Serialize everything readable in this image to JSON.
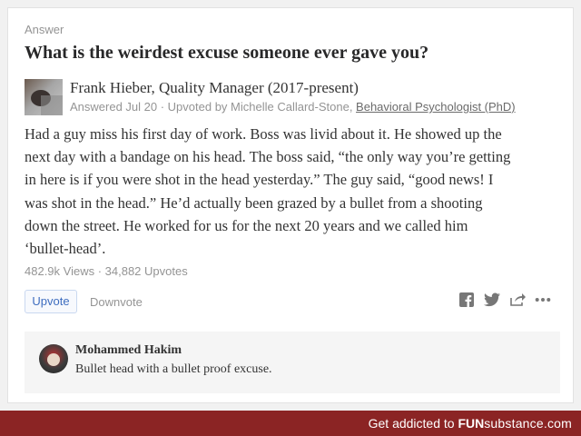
{
  "answer_label": "Answer",
  "question": "What is the weirdest excuse someone ever gave you?",
  "author": {
    "line": "Frank Hieber, Quality Manager (2017-present)",
    "meta_prefix": "Answered Jul 20 · Upvoted by Michelle Callard-Stone, ",
    "meta_credential": "Behavioral Psychologist (PhD)"
  },
  "body_lines": [
    "Had a guy miss his first day of work. Boss was livid about it. He showed up the",
    "next day with a bandage on his head. The boss said, “the only way you’re getting",
    "in here is if you were shot in the head yesterday.” The guy said, “good news! I",
    "was shot in the head.” He’d actually been grazed by a bullet from a shooting",
    "down the street. He worked for us for the next 20 years and we called him",
    "‘bullet-head’."
  ],
  "stats": "482.9k Views · 34,882 Upvotes",
  "actions": {
    "upvote": "Upvote",
    "downvote": "Downvote"
  },
  "share_icons": [
    "facebook-icon",
    "twitter-icon",
    "share-icon",
    "more-icon"
  ],
  "comment": {
    "author": "Mohammed Hakim",
    "text": "Bullet head with a bullet proof excuse."
  },
  "footer": {
    "prefix": "Get addicted to ",
    "brand_fun": "FUN",
    "brand_rest": "substance",
    "brand_tld": ".com"
  },
  "colors": {
    "footer_bg": "#8b2424",
    "link_blue": "#3e6dbf"
  }
}
